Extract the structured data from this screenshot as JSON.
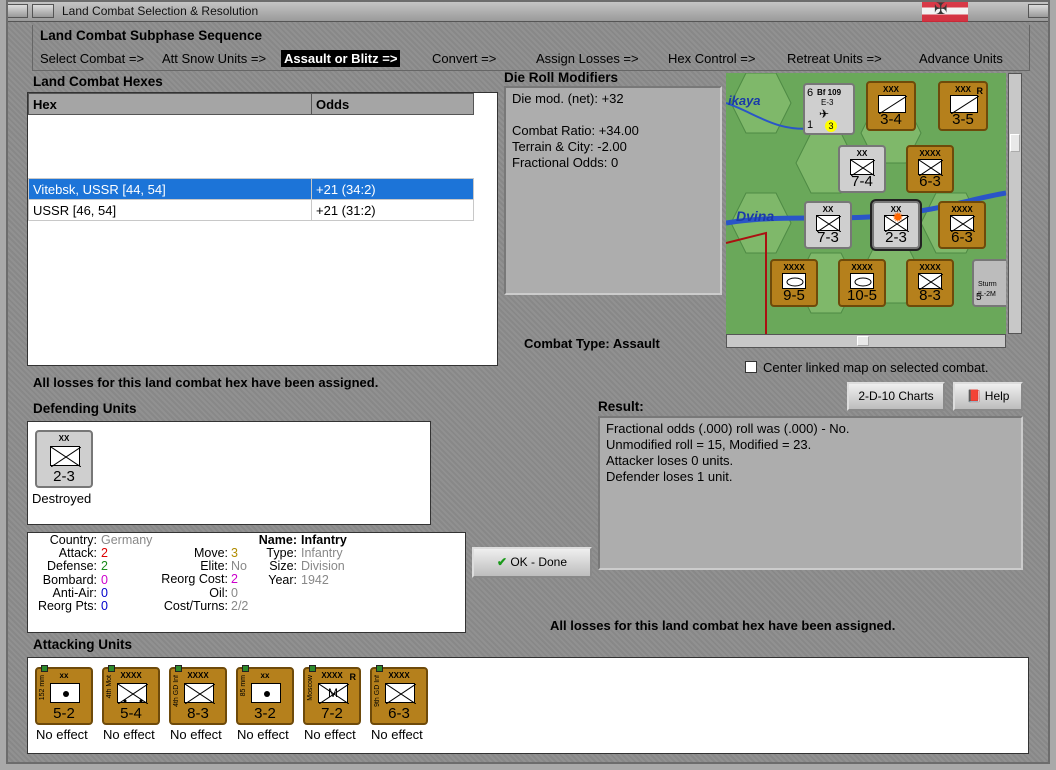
{
  "window": {
    "title": "Land Combat Selection & Resolution"
  },
  "subphase": {
    "heading": "Land Combat Subphase Sequence",
    "steps": [
      "Select Combat =>",
      "Att Snow Units =>",
      "Assault or Blitz =>",
      "Convert =>",
      "Assign Losses =>",
      "Hex Control =>",
      "Retreat Units =>",
      "Advance Units"
    ],
    "selected_index": 2
  },
  "hexes": {
    "heading": "Land Combat Hexes",
    "col_hex": "Hex",
    "col_odds": "Odds",
    "rows": [
      {
        "hex": "Vitebsk, USSR [44, 54]",
        "odds": "+21 (34:2)",
        "selected": true
      },
      {
        "hex": "USSR [46, 54]",
        "odds": "+21 (31:2)",
        "selected": false
      }
    ]
  },
  "modifiers": {
    "heading": "Die Roll Modifiers",
    "net": "Die mod. (net): +32",
    "ratio": "Combat Ratio: +34.00",
    "terrain": "Terrain & City: -2.00",
    "fractional": "Fractional Odds: 0"
  },
  "combat_type": {
    "label": "Combat Type:",
    "value": "Assault"
  },
  "map": {
    "labels": {
      "kaya": "ikaya",
      "dvina": "Dvina"
    },
    "center_label": "Center linked map on selected combat.",
    "center_checked": false,
    "units": [
      {
        "size": "XXX",
        "val": "3-4",
        "side": "7th Cav"
      },
      {
        "size": "XXX",
        "val": "3-5",
        "side": "1st GT",
        "corner": "R"
      },
      {
        "size": "XX",
        "val": "7-4",
        "side": "131st Inf"
      },
      {
        "size": "XXXX",
        "val": "6-3",
        "side": "53rd Inf"
      },
      {
        "size": "XX",
        "val": "7-3",
        "side": "3rd Inf"
      },
      {
        "size": "XX",
        "val": "2-3",
        "side": ""
      },
      {
        "size": "XXXX",
        "val": "6-3",
        "side": "4th Inf"
      },
      {
        "size": "XXXX",
        "val": "9-5",
        "side": "1st GT Arm"
      },
      {
        "size": "XXXX",
        "val": "10-5",
        "side": "2nd GD Arm"
      },
      {
        "size": "XXXX",
        "val": "8-3",
        "side": "4th GD Inf"
      }
    ],
    "air": {
      "name": "Bf 109",
      "rating": "E-3",
      "top": "6",
      "bottom": "1",
      "badge": "3"
    },
    "air2": {
      "name": "Sturm",
      "sub": "IL-2M",
      "bottom": "5"
    }
  },
  "loss_msg": "All losses for this land combat hex have been assigned.",
  "defending": {
    "heading": "Defending Units",
    "units": [
      {
        "size": "XX",
        "val": "2-3",
        "status": "Destroyed"
      }
    ]
  },
  "buttons": {
    "charts": "2-D-10 Charts",
    "help": "Help",
    "ok": "OK - Done"
  },
  "result": {
    "heading": "Result:",
    "lines": [
      "Fractional odds (.000) roll was (.000)  - No.",
      "Unmodified roll = 15, Modified = 23.",
      "Attacker loses 0 units.",
      "Defender loses 1 unit."
    ]
  },
  "info": {
    "country_lbl": "Country:",
    "country": "Germany",
    "attack_lbl": "Attack:",
    "attack": "2",
    "defense_lbl": "Defense:",
    "defense": "2",
    "bombard_lbl": "Bombard:",
    "bombard": "0",
    "aa_lbl": "Anti-Air:",
    "aa": "0",
    "reorg_lbl": "Reorg Pts:",
    "reorg": "0",
    "move_lbl": "Move:",
    "move": "3",
    "elite_lbl": "Elite:",
    "elite": "No",
    "rcost_lbl": "Reorg Cost:",
    "rcost": "2",
    "oil_lbl": "Oil:",
    "oil": "0",
    "cost_lbl": "Cost/Turns:",
    "cost": "2/2",
    "name_lbl": "Name:",
    "name": "Infantry",
    "type_lbl": "Type:",
    "type": "Infantry",
    "sizev_lbl": "Size:",
    "sizev": "Division",
    "year_lbl": "Year:",
    "year": "1942"
  },
  "attacking": {
    "heading": "Attacking Units",
    "units": [
      {
        "size": "xx",
        "side": "152 mm",
        "val": "5-2",
        "kind": "art",
        "status": "No effect"
      },
      {
        "size": "XXXX",
        "side": "4th Mot",
        "val": "5-4",
        "kind": "mot",
        "status": "No effect"
      },
      {
        "size": "XXXX",
        "side": "4th GD Inf",
        "val": "8-3",
        "kind": "inf",
        "status": "No effect"
      },
      {
        "size": "xx",
        "side": "85 mm",
        "val": "3-2",
        "kind": "art",
        "status": "No effect"
      },
      {
        "size": "XXXX",
        "side": "Moscow",
        "val": "7-2",
        "kind": "mil",
        "status": "No effect",
        "corner": "R",
        "mark": "M"
      },
      {
        "size": "XXXX",
        "side": "9th GD Inf",
        "val": "6-3",
        "kind": "inf",
        "status": "No effect"
      }
    ]
  }
}
